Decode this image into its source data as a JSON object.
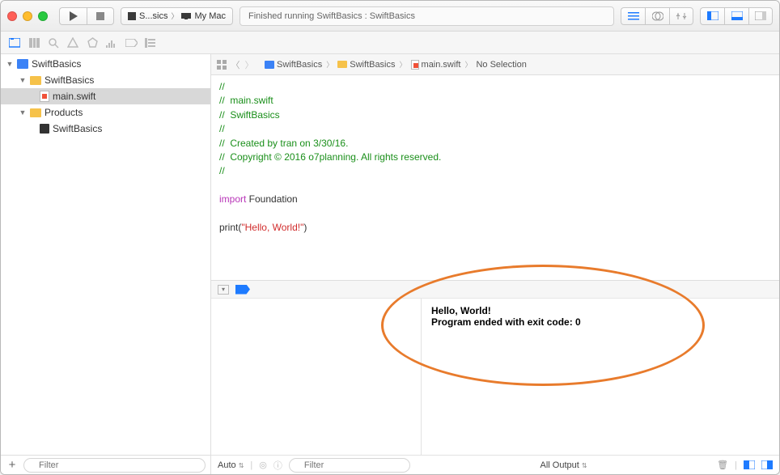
{
  "toolbar": {
    "scheme_target": "S...sics",
    "scheme_device": "My Mac",
    "status": "Finished running SwiftBasics : SwiftBasics"
  },
  "navigator": {
    "root": "SwiftBasics",
    "group": "SwiftBasics",
    "file_main": "main.swift",
    "group_products": "Products",
    "product": "SwiftBasics",
    "filter_placeholder": "Filter"
  },
  "jumpbar": {
    "project": "SwiftBasics",
    "group": "SwiftBasics",
    "file": "main.swift",
    "selection": "No Selection"
  },
  "code": {
    "l1": "//",
    "l2": "//  main.swift",
    "l3": "//  SwiftBasics",
    "l4": "//",
    "l5": "//  Created by tran on 3/30/16.",
    "l6": "//  Copyright © 2016 o7planning. All rights reserved.",
    "l7": "//",
    "import_kw": "import",
    "import_mod": " Foundation",
    "print_fn": "print",
    "print_open": "(",
    "print_str": "\"Hello, World!\"",
    "print_close": ")"
  },
  "console": {
    "line1": "Hello, World!",
    "line2": "Program ended with exit code: 0"
  },
  "debugbar": {
    "auto": "Auto",
    "filter_placeholder": "Filter",
    "all_output": "All Output"
  }
}
